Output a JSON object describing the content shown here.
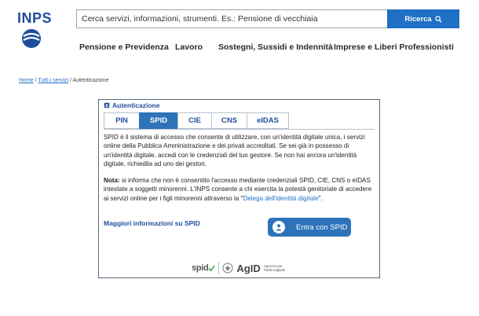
{
  "header": {
    "logo_text": "INPS",
    "search_placeholder": "Cerca servizi, informazioni, strumenti. Es.: Pensione di vecchiaia",
    "search_button": "Ricerca"
  },
  "nav": [
    "Pensione e Previdenza",
    "Lavoro",
    "Sostegni, Sussidi e Indennità",
    "Imprese e Liberi Professionisti"
  ],
  "breadcrumb": {
    "home": "Home",
    "all_services": "Tutti i servizi",
    "separator": "/",
    "current": "Autenticazione"
  },
  "auth": {
    "title": "Autenticazione",
    "tabs": [
      "PIN",
      "SPID",
      "CIE",
      "CNS",
      "eIDAS"
    ],
    "active_tab": "SPID",
    "intro": "SPID è il sistema di accesso che consente di utilizzare, con un'identità digitale unica, i servizi online della Pubblica Amministrazione e dei privati accreditati. Se sei già in possesso di un'identità digitale, accedi con le credenziali del tuo gestore. Se non hai ancora un'identità digitale, richiedila ad uno dei gestori.",
    "note_label": "Nota:",
    "note_text": "si informa che non è consentito l'accesso mediante credenziali SPID, CIE, CNS o eIDAS intestate a soggetti minorenni. L'INPS consente a chi esercita la potestà genitoriale di accedere ai servizi online per i figli minorenni attraverso la \"",
    "note_link": "Delega dell'identità digitale",
    "note_end": "\".",
    "more_info": "Maggiori informazioni su SPID",
    "login_button": "Entra con SPID",
    "footer_spid": "spid",
    "footer_agid": "AgID",
    "footer_agid_sub": "Agenzia per l'Italia Digitale"
  },
  "colors": {
    "brand_blue": "#1f4e9d",
    "button_blue": "#2d73b9",
    "search_blue": "#1f6fc5"
  }
}
